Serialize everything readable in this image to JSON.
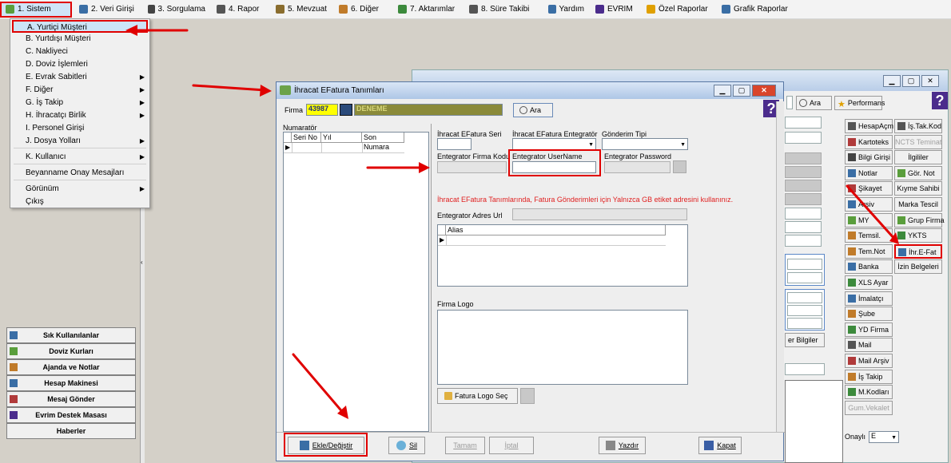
{
  "menubar": {
    "items": [
      {
        "label": "1.  Sistem",
        "color": "#5a9e3c"
      },
      {
        "label": "2.  Veri Girişi",
        "color": "#3a6ea5"
      },
      {
        "label": "3.  Sorgulama",
        "color": "#444"
      },
      {
        "label": "4.  Rapor",
        "color": "#555"
      },
      {
        "label": "5.  Mevzuat",
        "color": "#8a6d2e"
      },
      {
        "label": "6.  Diğer",
        "color": "#c07b2a"
      },
      {
        "label": "7.  Aktarımlar",
        "color": "#3c8a3c"
      },
      {
        "label": "8. Süre Takibi",
        "color": "#555"
      },
      {
        "label": "Yardım",
        "color": "#3a6ea5"
      },
      {
        "label": "EVRIM",
        "color": "#4b2c8c"
      },
      {
        "label": "Özel Raporlar",
        "color": "#e0a000"
      },
      {
        "label": "Grafik Raporlar",
        "color": "#3a6ea5"
      }
    ]
  },
  "dropdown": {
    "items": [
      {
        "label": "A.  Yurtiçi Müşteri",
        "arrow": ""
      },
      {
        "label": "B.  Yurtdışı Müşteri",
        "arrow": ""
      },
      {
        "label": "C.  Nakliyeci",
        "arrow": ""
      },
      {
        "label": "D.  Doviz İşlemleri",
        "arrow": ""
      },
      {
        "label": "E.  Evrak Sabitleri",
        "arrow": "▶"
      },
      {
        "label": "F.  Diğer",
        "arrow": "▶"
      },
      {
        "label": "G.  İş Takip",
        "arrow": "▶"
      },
      {
        "label": "H.  İhracatçı Birlik",
        "arrow": "▶"
      },
      {
        "label": "I.   Personel Girişi",
        "arrow": ""
      },
      {
        "label": "J.  Dosya Yolları",
        "arrow": "▶"
      },
      {
        "label": "K.  Kullanıcı",
        "arrow": "▶"
      },
      {
        "label": "Beyanname Onay Mesajları",
        "arrow": ""
      },
      {
        "label": "Görünüm",
        "arrow": "▶"
      },
      {
        "label": "Çıkış",
        "arrow": ""
      }
    ]
  },
  "shortcuts": [
    {
      "label": "Sık Kullanılanlar",
      "color": "#3a6ea5"
    },
    {
      "label": "Doviz Kurları",
      "color": "#5a9e3c"
    },
    {
      "label": "Ajanda ve Notlar",
      "color": "#c07b2a"
    },
    {
      "label": "Hesap Makinesi",
      "color": "#3a6ea5"
    },
    {
      "label": "Mesaj Gönder",
      "color": "#b03a3a"
    },
    {
      "label": "Evrim Destek Masası",
      "color": "#4b2c8c"
    },
    {
      "label": "Haberler",
      "color": ""
    }
  ],
  "bgwindow": {
    "search_label": "Ara",
    "performans_label": "Performans",
    "qmark": "?",
    "other_info_label": "er Bilgiler",
    "onayli_label": "Onaylı",
    "onayli_value": "E",
    "right_buttons": [
      {
        "label": "HesapAçm",
        "color": "#555",
        "disabled": false
      },
      {
        "label": "İş.Tak.Kod",
        "color": "#555",
        "disabled": false
      },
      {
        "label": "Kartoteks",
        "color": "#b03a3a",
        "disabled": false
      },
      {
        "label": "NCTS Teminat",
        "color": "",
        "disabled": true
      },
      {
        "label": "Bilgi Girişi",
        "color": "#444",
        "disabled": false
      },
      {
        "label": "İlgililer",
        "color": "",
        "disabled": false
      },
      {
        "label": "Notlar",
        "color": "#3a6ea5",
        "disabled": false
      },
      {
        "label": "Gör. Not",
        "color": "#5a9e3c",
        "disabled": false
      },
      {
        "label": "Şikayet",
        "color": "#b03a3a",
        "disabled": false
      },
      {
        "label": "Kıyme Sahibi",
        "color": "",
        "disabled": false
      },
      {
        "label": "Arşiv",
        "color": "#3a6ea5",
        "disabled": false
      },
      {
        "label": "Marka Tescil",
        "color": "",
        "disabled": false
      },
      {
        "label": "MY",
        "color": "#5a9e3c",
        "disabled": false
      },
      {
        "label": "Grup Firma",
        "color": "#5a9e3c",
        "disabled": false
      },
      {
        "label": "Temsil.",
        "color": "#c07b2a",
        "disabled": false
      },
      {
        "label": "YKTS",
        "color": "#3c8a3c",
        "disabled": false
      },
      {
        "label": "Tem.Not",
        "color": "#c07b2a",
        "disabled": false
      },
      {
        "label": "İhr.E-Fat",
        "color": "#3a6ea5",
        "disabled": false
      },
      {
        "label": "Banka",
        "color": "#3a6ea5",
        "disabled": false
      },
      {
        "label": "İzin Belgeleri",
        "color": "",
        "disabled": false
      },
      {
        "label": "XLS Ayar",
        "color": "#3c8a3c",
        "disabled": false
      },
      {
        "label": "İmalatçı",
        "color": "#3a6ea5",
        "disabled": false
      },
      {
        "label": "Şube",
        "color": "#c07b2a",
        "disabled": false
      },
      {
        "label": "YD Firma",
        "color": "#3c8a3c",
        "disabled": false
      },
      {
        "label": "Mail",
        "color": "#555",
        "disabled": false
      },
      {
        "label": "Mail Arşiv",
        "color": "#b03a3a",
        "disabled": false
      },
      {
        "label": "İş Takip",
        "color": "#c07b2a",
        "disabled": false
      },
      {
        "label": "M.Kodları",
        "color": "#3c8a3c",
        "disabled": false
      },
      {
        "label": "Gum.Vekalet",
        "color": "",
        "disabled": true
      }
    ]
  },
  "dialog": {
    "title": "İhracat EFatura Tanımları",
    "firma_label": "Firma",
    "firma_code": "43987",
    "firma_name": "DENEME",
    "ara_label": "Ara",
    "qmark": "?",
    "numaratorler_label": "Numaratör",
    "grid_headers": [
      "Seri No",
      "Yıl",
      "Son Numara"
    ],
    "seri_label": "İhracat EFatura Seri",
    "entegrator_label": "İhracat EFatura Entegratör",
    "gonderim_label": "Gönderim Tipi",
    "firma_kodu_label": "Entegrator Firma Kodu",
    "username_label": "Entegrator UserName",
    "password_label": "Entegrator Password",
    "warning": "İhracat EFatura Tanımlarında, Fatura Gönderimleri için Yalnızca GB etiket adresini kullanınız.",
    "adres_url_label": "Entegrator Adres Url",
    "alias_header": "Alias",
    "logo_label": "Firma Logo",
    "logo_button": "Fatura Logo Seç",
    "buttons": {
      "ekle": "Ekle/Değiştir",
      "sil": "Sil",
      "tamam": "Tamam",
      "iptal": "İptal",
      "yazdir": "Yazdır",
      "kapat": "Kapat"
    }
  }
}
